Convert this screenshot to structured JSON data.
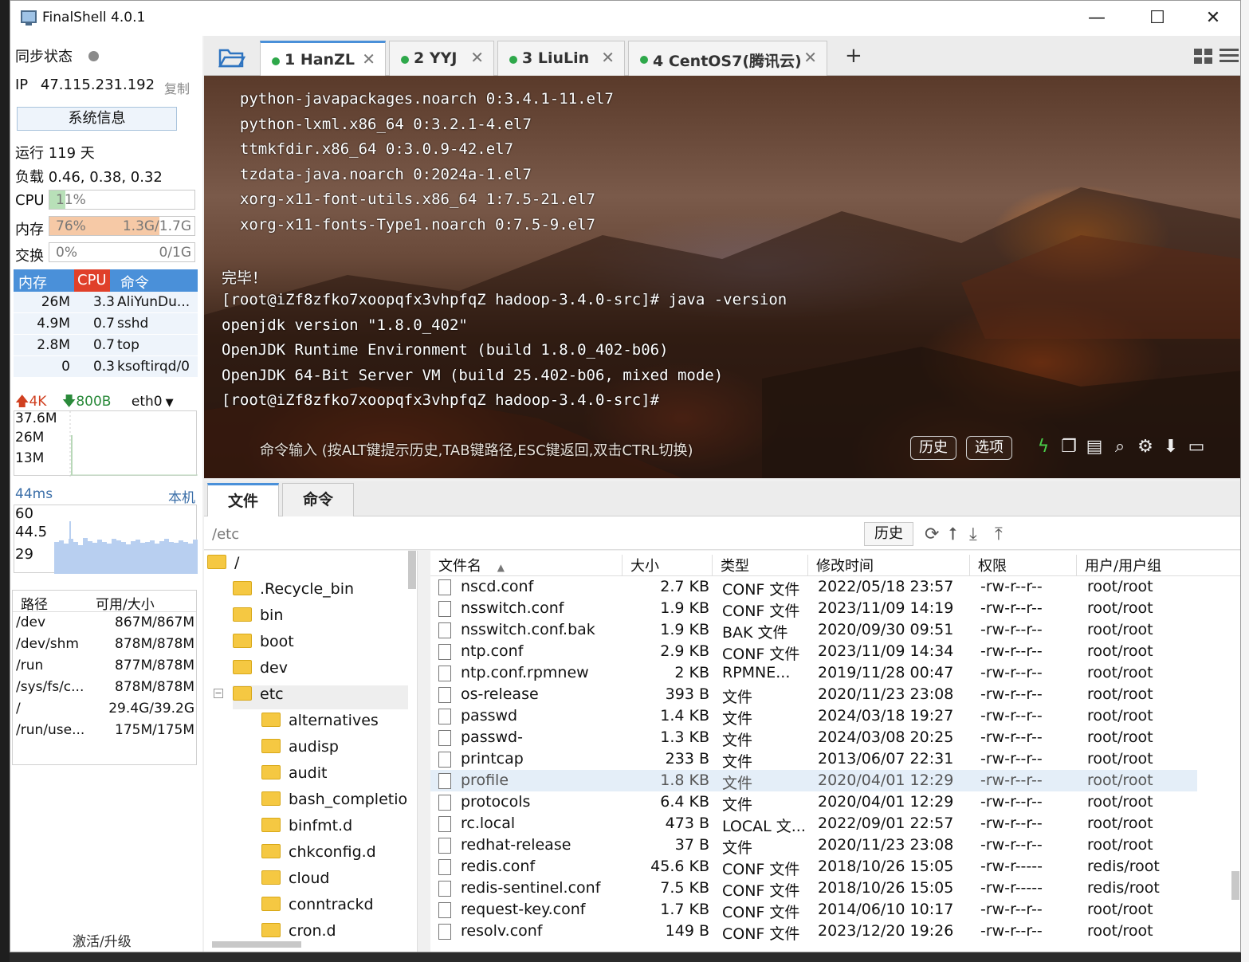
{
  "window": {
    "title": "FinalShell 4.0.1",
    "minimize": "—",
    "maximize": "☐",
    "close": "✕"
  },
  "left": {
    "sync_label": "同步状态",
    "ip_label": "IP",
    "ip": "47.115.231.192",
    "copy": "复制",
    "sysinfo_button": "系统信息",
    "uptime": "运行 119 天",
    "load": "负载 0.46, 0.38, 0.32",
    "cpu": {
      "label": "CPU",
      "value": "11%",
      "fraction": 0.11
    },
    "mem": {
      "label": "内存",
      "value": "76%",
      "detail": "1.3G/1.7G",
      "fraction": 0.76
    },
    "swap": {
      "label": "交换",
      "value": "0%",
      "detail": "0/1G",
      "fraction": 0
    },
    "proc_headers": [
      "内存",
      "CPU",
      "命令"
    ],
    "procs": [
      {
        "mem": "26M",
        "cpu": "3.3",
        "cmd": "AliYunDu..."
      },
      {
        "mem": "4.9M",
        "cpu": "0.7",
        "cmd": "sshd"
      },
      {
        "mem": "2.8M",
        "cpu": "0.7",
        "cmd": "top"
      },
      {
        "mem": "0",
        "cpu": "0.3",
        "cmd": "ksoftirqd/0"
      }
    ],
    "net": {
      "up": "4K",
      "down": "800B",
      "iface": "eth0",
      "y_labels": [
        "37.6M",
        "26M",
        "13M"
      ]
    },
    "ping": {
      "latency": "44ms",
      "host": "本机",
      "y_labels": [
        "60",
        "44.5",
        "29"
      ]
    },
    "disk_headers": [
      "路径",
      "可用/大小"
    ],
    "disks": [
      {
        "path": "/dev",
        "size": "867M/867M"
      },
      {
        "path": "/dev/shm",
        "size": "878M/878M"
      },
      {
        "path": "/run",
        "size": "877M/878M"
      },
      {
        "path": "/sys/fs/c...",
        "size": "878M/878M"
      },
      {
        "path": "/",
        "size": "29.4G/39.2G"
      },
      {
        "path": "/run/use...",
        "size": "175M/175M"
      }
    ],
    "activate": "激活/升级"
  },
  "tabs": [
    {
      "label": "1 HanZL",
      "active": true
    },
    {
      "label": "2 YYJ",
      "active": false
    },
    {
      "label": "3 LiuLin",
      "active": false
    },
    {
      "label": "4 CentOS7(腾讯云)",
      "active": false
    }
  ],
  "tab_add": "+",
  "terminal": {
    "lines": [
      "  python-javapackages.noarch 0:3.4.1-11.el7",
      "  python-lxml.x86_64 0:3.2.1-4.el7",
      "  ttmkfdir.x86_64 0:3.0.9-42.el7",
      "  tzdata-java.noarch 0:2024a-1.el7",
      "  xorg-x11-font-utils.x86_64 1:7.5-21.el7",
      "  xorg-x11-fonts-Type1.noarch 0:7.5-9.el7",
      "",
      "完毕！",
      "[root@iZf8zfko7xoopqfx3vhpfqZ hadoop-3.4.0-src]# java -version",
      "openjdk version \"1.8.0_402\"",
      "OpenJDK Runtime Environment (build 1.8.0_402-b06)",
      "OpenJDK 64-Bit Server VM (build 25.402-b06, mixed mode)",
      "[root@iZf8zfko7xoopqfx3vhpfqZ hadoop-3.4.0-src]#"
    ],
    "cmd_hint": "命令输入 (按ALT键提示历史,TAB键路径,ESC键返回,双击CTRL切换)",
    "history_button": "历史",
    "options_button": "选项"
  },
  "files": {
    "tabs": [
      "文件",
      "命令"
    ],
    "path": "/etc",
    "history_button": "历史",
    "tree": [
      {
        "name": "/",
        "level": 0
      },
      {
        "name": ".Recycle_bin",
        "level": 1
      },
      {
        "name": "bin",
        "level": 1
      },
      {
        "name": "boot",
        "level": 1
      },
      {
        "name": "dev",
        "level": 1
      },
      {
        "name": "etc",
        "level": 1,
        "expanded": true
      },
      {
        "name": "alternatives",
        "level": 2
      },
      {
        "name": "audisp",
        "level": 2
      },
      {
        "name": "audit",
        "level": 2
      },
      {
        "name": "bash_completio",
        "level": 2
      },
      {
        "name": "binfmt.d",
        "level": 2
      },
      {
        "name": "chkconfig.d",
        "level": 2
      },
      {
        "name": "cloud",
        "level": 2
      },
      {
        "name": "conntrackd",
        "level": 2
      },
      {
        "name": "cron.d",
        "level": 2
      }
    ],
    "headers": [
      "文件名",
      "大小",
      "类型",
      "修改时间",
      "权限",
      "用户/用户组"
    ],
    "rows": [
      {
        "name": "nscd.conf",
        "size": "2.7 KB",
        "type": "CONF 文件",
        "mtime": "2022/05/18 23:57",
        "perm": "-rw-r--r--",
        "owner": "root/root"
      },
      {
        "name": "nsswitch.conf",
        "size": "1.9 KB",
        "type": "CONF 文件",
        "mtime": "2023/11/09 14:19",
        "perm": "-rw-r--r--",
        "owner": "root/root"
      },
      {
        "name": "nsswitch.conf.bak",
        "size": "1.9 KB",
        "type": "BAK 文件",
        "mtime": "2020/09/30 09:51",
        "perm": "-rw-r--r--",
        "owner": "root/root"
      },
      {
        "name": "ntp.conf",
        "size": "2.9 KB",
        "type": "CONF 文件",
        "mtime": "2023/11/09 14:34",
        "perm": "-rw-r--r--",
        "owner": "root/root"
      },
      {
        "name": "ntp.conf.rpmnew",
        "size": "2 KB",
        "type": "RPMNE...",
        "mtime": "2019/11/28 00:47",
        "perm": "-rw-r--r--",
        "owner": "root/root"
      },
      {
        "name": "os-release",
        "size": "393 B",
        "type": "文件",
        "mtime": "2020/11/23 23:08",
        "perm": "-rw-r--r--",
        "owner": "root/root"
      },
      {
        "name": "passwd",
        "size": "1.4 KB",
        "type": "文件",
        "mtime": "2024/03/18 19:27",
        "perm": "-rw-r--r--",
        "owner": "root/root"
      },
      {
        "name": "passwd-",
        "size": "1.3 KB",
        "type": "文件",
        "mtime": "2024/03/08 20:25",
        "perm": "-rw-r--r--",
        "owner": "root/root"
      },
      {
        "name": "printcap",
        "size": "233 B",
        "type": "文件",
        "mtime": "2013/06/07 22:31",
        "perm": "-rw-r--r--",
        "owner": "root/root"
      },
      {
        "name": "profile",
        "size": "1.8 KB",
        "type": "文件",
        "mtime": "2020/04/01 12:29",
        "perm": "-rw-r--r--",
        "owner": "root/root",
        "selected": true
      },
      {
        "name": "protocols",
        "size": "6.4 KB",
        "type": "文件",
        "mtime": "2020/04/01 12:29",
        "perm": "-rw-r--r--",
        "owner": "root/root"
      },
      {
        "name": "rc.local",
        "size": "473 B",
        "type": "LOCAL 文...",
        "mtime": "2022/09/01 22:57",
        "perm": "-rw-r--r--",
        "owner": "root/root"
      },
      {
        "name": "redhat-release",
        "size": "37 B",
        "type": "文件",
        "mtime": "2020/11/23 23:08",
        "perm": "-rw-r--r--",
        "owner": "root/root"
      },
      {
        "name": "redis.conf",
        "size": "45.6 KB",
        "type": "CONF 文件",
        "mtime": "2018/10/26 15:05",
        "perm": "-rw-r-----",
        "owner": "redis/root"
      },
      {
        "name": "redis-sentinel.conf",
        "size": "7.5 KB",
        "type": "CONF 文件",
        "mtime": "2018/10/26 15:05",
        "perm": "-rw-r-----",
        "owner": "redis/root"
      },
      {
        "name": "request-key.conf",
        "size": "1.7 KB",
        "type": "CONF 文件",
        "mtime": "2014/06/10 10:17",
        "perm": "-rw-r--r--",
        "owner": "root/root"
      },
      {
        "name": "resolv.conf",
        "size": "149 B",
        "type": "CONF 文件",
        "mtime": "2023/12/20 19:26",
        "perm": "-rw-r--r--",
        "owner": "root/root"
      }
    ]
  },
  "colors": {
    "accent": "#4a90d9",
    "mem_fill": "#f6c9a6",
    "cpu_fill": "#b8e0b8",
    "online_dot": "#2ea84a",
    "upload": "#d04020",
    "download": "#2a8a3a"
  }
}
